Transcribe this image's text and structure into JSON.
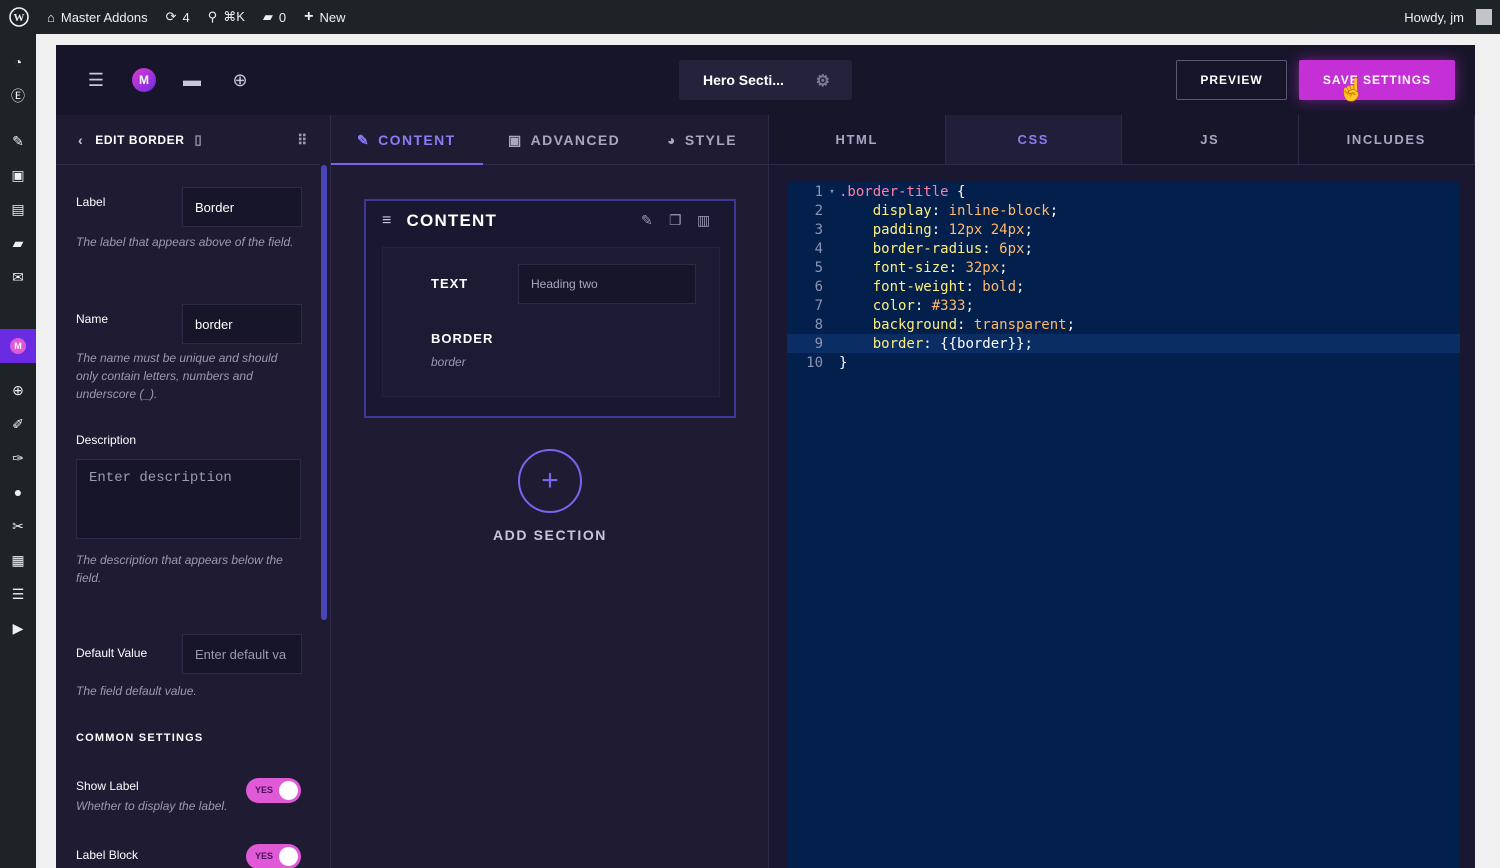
{
  "adminbar": {
    "site_name": "Master Addons",
    "updates_count": "4",
    "search_shortcut": "⌘K",
    "comments_count": "0",
    "new_label": "New",
    "greeting": "Howdy, jm"
  },
  "rail_icons": [
    "dashboard-icon",
    "elementor-icon",
    "pin-icon",
    "media-icon",
    "pages-icon",
    "comments-icon",
    "mail-icon",
    "master-addons-icon",
    "plus-icon",
    "brush-icon",
    "plugins-icon",
    "users-icon",
    "tools-icon",
    "settings-icon",
    "table-icon",
    "play-icon"
  ],
  "topbar": {
    "widget_title": "Hero Secti...",
    "preview_label": "PREVIEW",
    "save_label": "SAVE SETTINGS"
  },
  "left_panel": {
    "header_title": "EDIT BORDER",
    "label_field": {
      "label": "Label",
      "value": "Border",
      "help": "The label that appears above of the field."
    },
    "name_field": {
      "label": "Name",
      "value": "border",
      "help": "The name must be unique and should only contain letters, numbers and underscore (_)."
    },
    "description_field": {
      "label": "Description",
      "placeholder": "Enter description",
      "help": "The description that appears below the field."
    },
    "default_field": {
      "label": "Default Value",
      "placeholder": "Enter default va",
      "help": "The field default value."
    },
    "common_settings_title": "COMMON SETTINGS",
    "show_label": {
      "label": "Show Label",
      "help": "Whether to display the label.",
      "toggle": "YES"
    },
    "label_block": {
      "label": "Label Block",
      "toggle": "YES"
    }
  },
  "middle_panel": {
    "tabs": [
      {
        "label": "CONTENT",
        "icon": "pencil-icon"
      },
      {
        "label": "ADVANCED",
        "icon": "grid-icon"
      },
      {
        "label": "STYLE",
        "icon": "palette-icon"
      }
    ],
    "card_title": "CONTENT",
    "text_label": "TEXT",
    "text_value": "Heading two",
    "border_label": "BORDER",
    "border_sub": "border",
    "add_section_label": "ADD SECTION"
  },
  "right_panel": {
    "tabs": [
      "HTML",
      "CSS",
      "JS",
      "INCLUDES"
    ],
    "active_tab": "CSS",
    "code_lines": [
      {
        "n": "1",
        "sel": ".border-title",
        "rest": " {"
      },
      {
        "n": "2",
        "prop": "display",
        "val": "inline-block"
      },
      {
        "n": "3",
        "prop": "padding",
        "val": "12px 24px"
      },
      {
        "n": "4",
        "prop": "border-radius",
        "val": "6px"
      },
      {
        "n": "5",
        "prop": "font-size",
        "val": "32px"
      },
      {
        "n": "6",
        "prop": "font-weight",
        "val": "bold"
      },
      {
        "n": "7",
        "prop": "color",
        "val": "#333"
      },
      {
        "n": "8",
        "prop": "background",
        "val": "transparent"
      },
      {
        "n": "9",
        "prop": "border",
        "val": "{{border}}"
      },
      {
        "n": "10",
        "close": "}"
      }
    ],
    "highlighted_line": "9"
  },
  "colors": {
    "accent": "#7667ee",
    "save": "#c52fd6",
    "editor_bg": "#02204b"
  }
}
